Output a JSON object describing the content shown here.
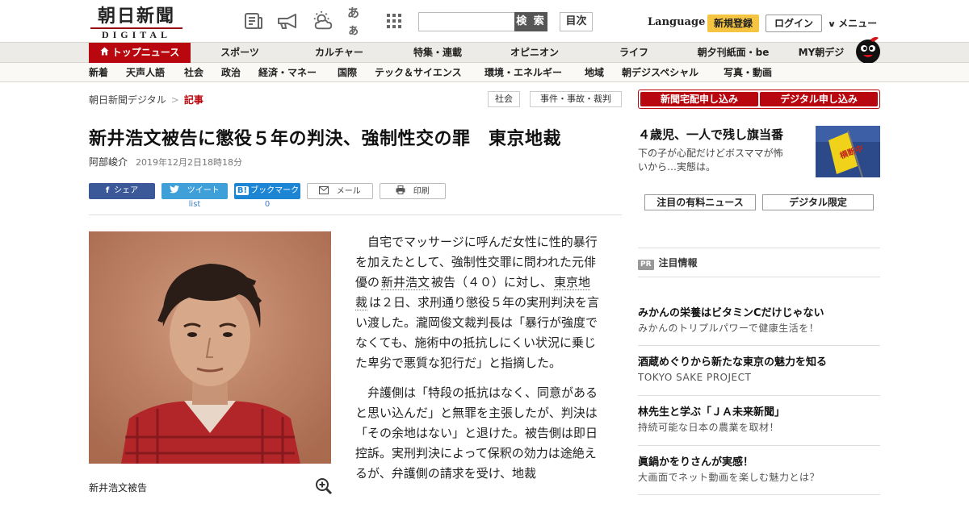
{
  "header": {
    "logo_main": "朝日新聞",
    "logo_sub": "DIGITAL",
    "search_button": "検 索",
    "toc_button": "目次",
    "language": "Language",
    "signup": "新規登録",
    "login": "ログイン",
    "menu": "メニュー",
    "icons": [
      "newspaper-icon",
      "megaphone-icon",
      "weather-icon",
      "font-size-icon",
      "grid-icon"
    ],
    "font_size_glyph": "あぁ"
  },
  "nav_main": [
    "トップニュース",
    "スポーツ",
    "カルチャー",
    "特集・連載",
    "オピニオン",
    "ライフ",
    "朝夕刊紙面・be",
    "MY朝デジ"
  ],
  "nav_sub": [
    "新着",
    "天声人語",
    "社会",
    "政治",
    "経済・マネー",
    "国際",
    "テック＆サイエンス",
    "環境・エネルギー",
    "地域",
    "朝デジスペシャル",
    "写真・動画"
  ],
  "breadcrumb": {
    "home": "朝日新聞デジタル",
    "sep": ">",
    "current": "記事"
  },
  "tags": [
    "社会",
    "事件・事故・裁判"
  ],
  "article": {
    "title": "新井浩文被告に懲役５年の判決、強制性交の罪　東京地裁",
    "author": "阿部峻介",
    "date": "2019年12月2日18時18分",
    "share": {
      "facebook": "シェア",
      "twitter": "ツイート",
      "hatena": "ブックマーク",
      "mail": "メール",
      "print": "印刷",
      "twitter_count": "list",
      "hatena_count": "0"
    },
    "caption": "新井浩文被告",
    "p1_a": "自宅でマッサージに呼んだ女性に性的暴行を加えたとして、強制性交罪に問われた元俳優の",
    "p1_link1": "新井浩文",
    "p1_b": "被告（４０）に対し、",
    "p1_link2": "東京地裁",
    "p1_c": "は２日、求刑通り懲役５年の実刑判決を言い渡した。瀧岡俊文裁判長は「暴行が強度でなくても、施術中の抵抗しにくい状況に乗じた卑劣で悪質な犯行だ」と指摘した。",
    "p2": "弁護側は「特段の抵抗はなく、同意があると思い込んだ」と無罪を主張したが、判決は「その余地はない」と退けた。被告側は即日控訴。実刑判決によって保釈の効力は途絶えるが、弁護側の請求を受け、地裁"
  },
  "sidebar": {
    "paper_subscribe": "新聞宅配申し込み",
    "digital_subscribe": "デジタル申し込み",
    "feature_title": "４歳児、一人で残し旗当番",
    "feature_desc": "下の子が心配だけどボスママが怖いから…実態は。",
    "feature_flag": "横断中",
    "tab_paid": "注目の有料ニュース",
    "tab_digital": "デジタル限定",
    "pr_badge": "PR",
    "pr_heading": "注目情報",
    "pr_items": [
      {
        "title": "みかんの栄養はビタミンCだけじゃない",
        "sub": "みかんのトリプルパワーで健康生活を！"
      },
      {
        "title": "酒蔵めぐりから新たな東京の魅力を知る",
        "sub": "TOKYO SAKE PROJECT"
      },
      {
        "title": "林先生と学ぶ「ＪＡ未来新聞」",
        "sub": "持続可能な日本の農業を取材！"
      },
      {
        "title": "眞鍋かをりさんが実感！",
        "sub": "大画面でネット動画を楽しむ魅力とは？"
      }
    ]
  },
  "colors": {
    "brand_red": "#b8070e",
    "signup_yellow": "#f5c440",
    "facebook": "#3b5998",
    "twitter": "#3e9fd9",
    "hatena": "#1d86d4"
  }
}
